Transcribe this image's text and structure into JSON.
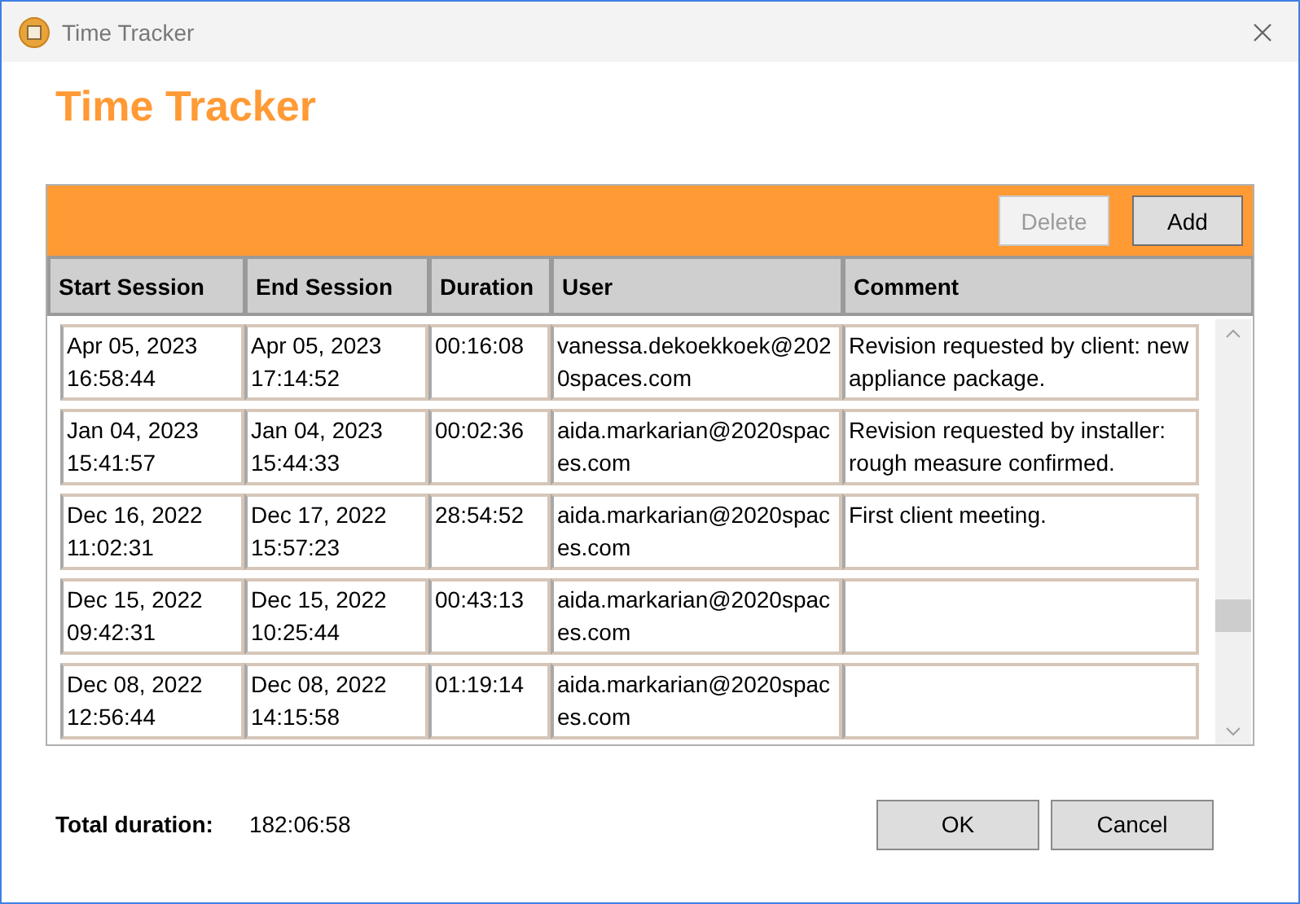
{
  "window": {
    "title": "Time Tracker"
  },
  "heading": "Time Tracker",
  "toolbar": {
    "buttons": [
      {
        "label": "Delete",
        "disabled": true
      },
      {
        "label": "Add",
        "disabled": false
      }
    ]
  },
  "table": {
    "columns": [
      "Start Session",
      "End Session",
      "Duration",
      "User",
      "Comment"
    ],
    "rows": [
      {
        "start": [
          "Apr 05, 2023",
          "16:58:44"
        ],
        "end": [
          "Apr 05, 2023",
          "17:14:52"
        ],
        "duration": "00:16:08",
        "user": "vanessa.dekoekkoek@2020spaces.com",
        "comment": "Revision requested by client: new appliance package."
      },
      {
        "start": [
          "Jan 04, 2023",
          "15:41:57"
        ],
        "end": [
          "Jan 04, 2023",
          "15:44:33"
        ],
        "duration": "00:02:36",
        "user": "aida.markarian@2020spaces.com",
        "comment": "Revision requested by installer: rough measure confirmed."
      },
      {
        "start": [
          "Dec 16, 2022",
          "11:02:31"
        ],
        "end": [
          "Dec 17, 2022",
          "15:57:23"
        ],
        "duration": "28:54:52",
        "user": "aida.markarian@2020spaces.com",
        "comment": "First client meeting."
      },
      {
        "start": [
          "Dec 15, 2022",
          "09:42:31"
        ],
        "end": [
          "Dec 15, 2022",
          "10:25:44"
        ],
        "duration": "00:43:13",
        "user": "aida.markarian@2020spaces.com",
        "comment": ""
      },
      {
        "start": [
          "Dec 08, 2022",
          "12:56:44"
        ],
        "end": [
          "Dec 08, 2022",
          "14:15:58"
        ],
        "duration": "01:19:14",
        "user": "aida.markarian@2020spaces.com",
        "comment": ""
      }
    ]
  },
  "footer": {
    "total_label": "Total duration:",
    "total_value": "182:06:58",
    "buttons": [
      "OK",
      "Cancel"
    ]
  }
}
